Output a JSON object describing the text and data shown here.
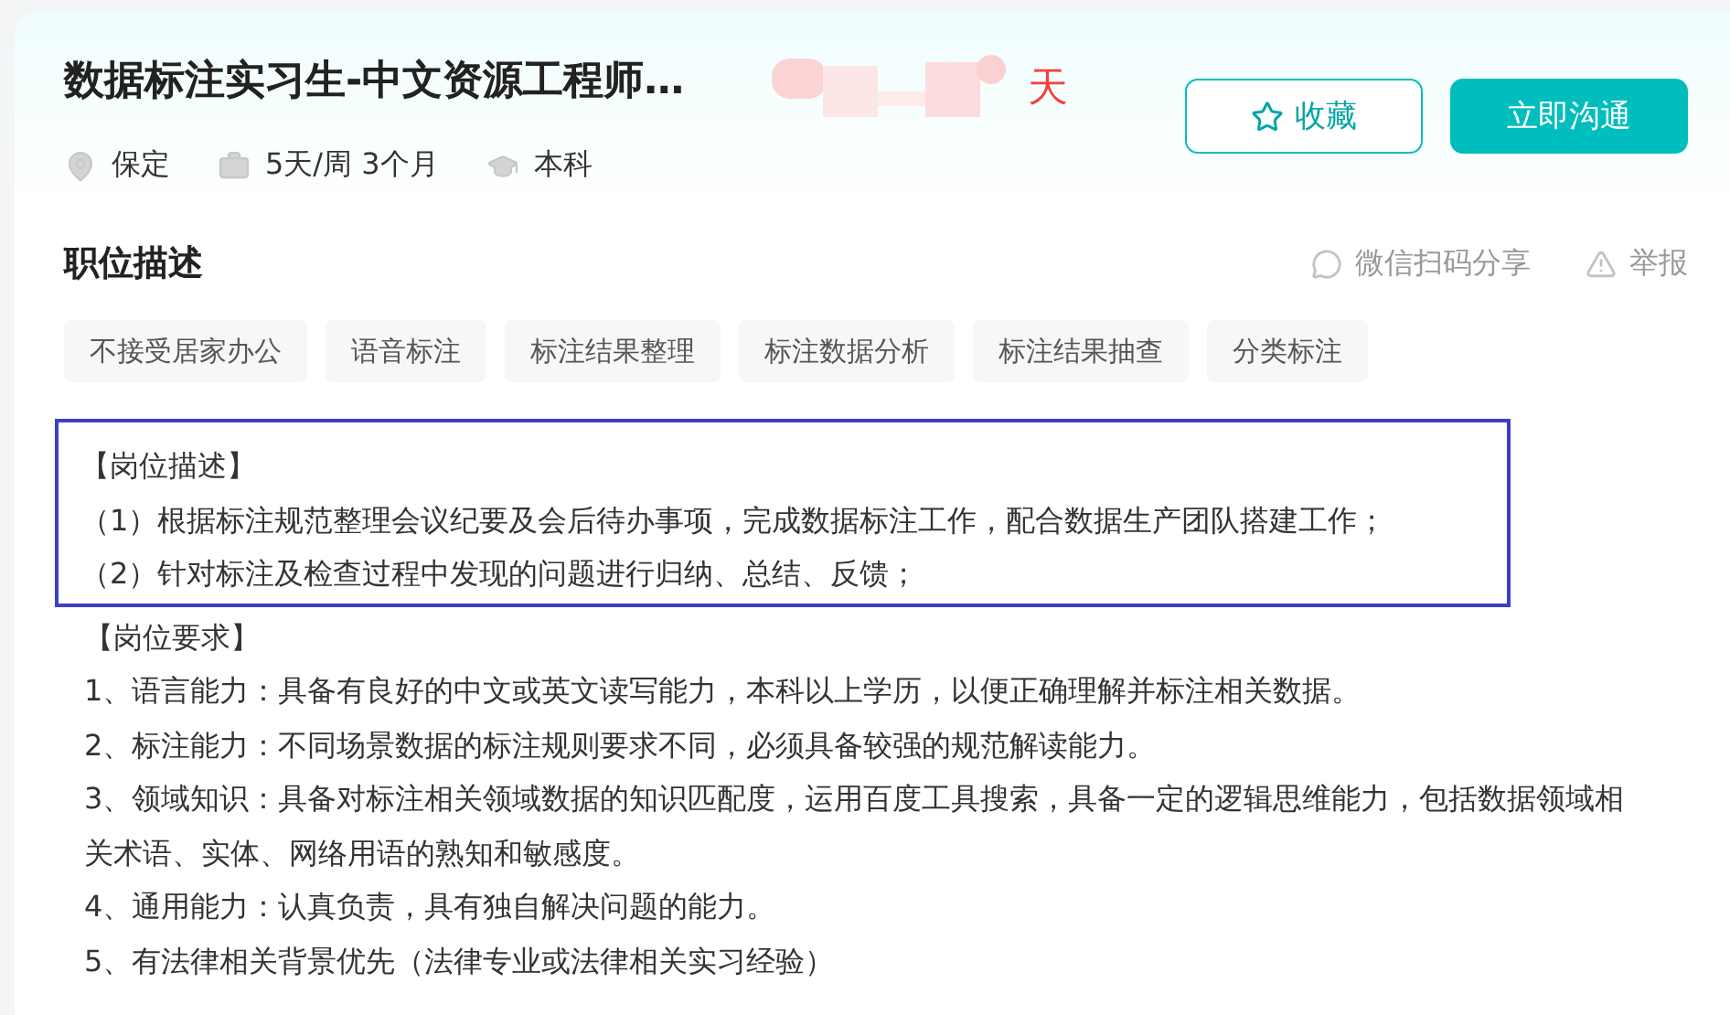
{
  "job": {
    "title": "数据标注实习生-中文资源工程师…",
    "salary_unit": "天",
    "salary_redacted": true,
    "meta": [
      {
        "kind": "location",
        "text": "保定"
      },
      {
        "kind": "schedule",
        "text": "5天/周 3个月"
      },
      {
        "kind": "degree",
        "text": "本科"
      }
    ],
    "buttons": [
      {
        "kind": "favorite",
        "label": "收藏"
      },
      {
        "kind": "chat",
        "label": "立即沟通"
      }
    ]
  },
  "section": {
    "title": "职位描述",
    "actions": [
      {
        "kind": "share",
        "label": "微信扫码分享"
      },
      {
        "kind": "report",
        "label": "举报"
      }
    ],
    "tags": [
      "不接受居家办公",
      "语音标注",
      "标注结果整理",
      "标注数据分析",
      "标注结果抽查",
      "分类标注"
    ]
  },
  "blocks": [
    {
      "highlighted": true,
      "lines": [
        "【岗位描述】",
        "（1）根据标注规范整理会议纪要及会后待办事项，完成数据标注工作，配合数据生产团队搭建工作；",
        "（2）针对标注及检查过程中发现的问题进行归纳、总结、反馈；"
      ]
    },
    {
      "highlighted": false,
      "lines": [
        "【岗位要求】",
        "1、语言能力：具备有良好的中文或英文读写能力，本科以上学历，以便正确理解并标注相关数据。",
        "2、标注能力：不同场景数据的标注规则要求不同，必须具备较强的规范解读能力。",
        "3、领域知识：具备对标注相关领域数据的知识匹配度，运用百度工具搜索，具备一定的逻辑思维能力，包括数据领域相关术语、实体、网络用语的熟知和敏感度。",
        "4、通用能力：认真负责，具有独自解决问题的能力。",
        "5、有法律相关背景优先（法律专业或法律相关实习经验）"
      ]
    }
  ]
}
